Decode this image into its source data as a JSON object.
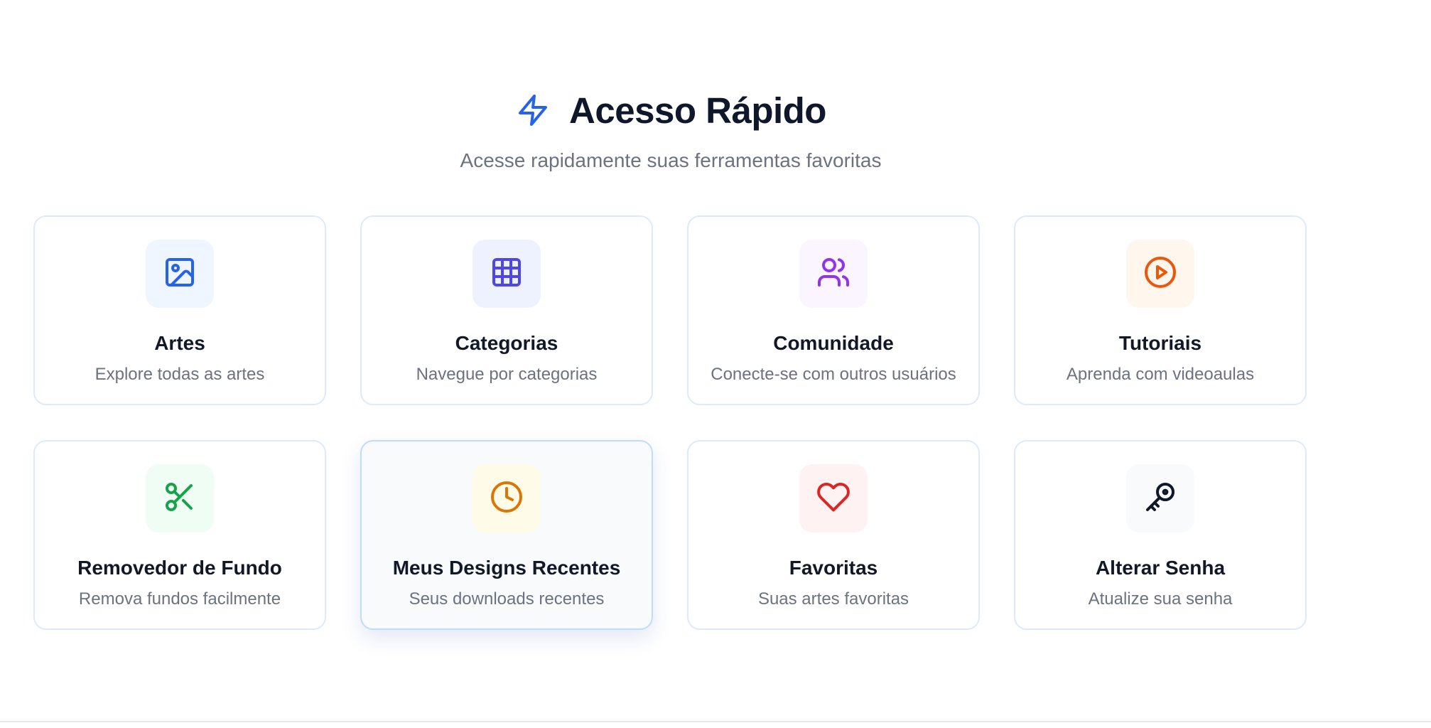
{
  "header": {
    "icon": "zap-icon",
    "title": "Acesso Rápido",
    "subtitle": "Acesse rapidamente suas ferramentas favoritas",
    "accent": "#2563eb"
  },
  "cards": [
    {
      "title": "Artes",
      "description": "Explore todas as artes",
      "icon": "image-icon",
      "color": "#2563eb",
      "bg": "#eff6ff"
    },
    {
      "title": "Categorias",
      "description": "Navegue por categorias",
      "icon": "grid-icon",
      "color": "#4f46e5",
      "bg": "#eef2ff"
    },
    {
      "title": "Comunidade",
      "description": "Conecte-se com outros usuários",
      "icon": "users-icon",
      "color": "#9333ea",
      "bg": "#faf5ff"
    },
    {
      "title": "Tutoriais",
      "description": "Aprenda com videoaulas",
      "icon": "play-circle-icon",
      "color": "#ea580c",
      "bg": "#fff7ed"
    },
    {
      "title": "Removedor de Fundo",
      "description": "Remova fundos facilmente",
      "icon": "scissors-icon",
      "color": "#16a34a",
      "bg": "#f0fdf4"
    },
    {
      "title": "Meus Designs Recentes",
      "description": "Seus downloads recentes",
      "icon": "clock-icon",
      "color": "#d97706",
      "bg": "#fefce8"
    },
    {
      "title": "Favoritas",
      "description": "Suas artes favoritas",
      "icon": "heart-icon",
      "color": "#dc2626",
      "bg": "#fef2f2"
    },
    {
      "title": "Alterar Senha",
      "description": "Atualize sua senha",
      "icon": "key-icon",
      "color": "#111827",
      "bg": "#f8fafc"
    }
  ]
}
